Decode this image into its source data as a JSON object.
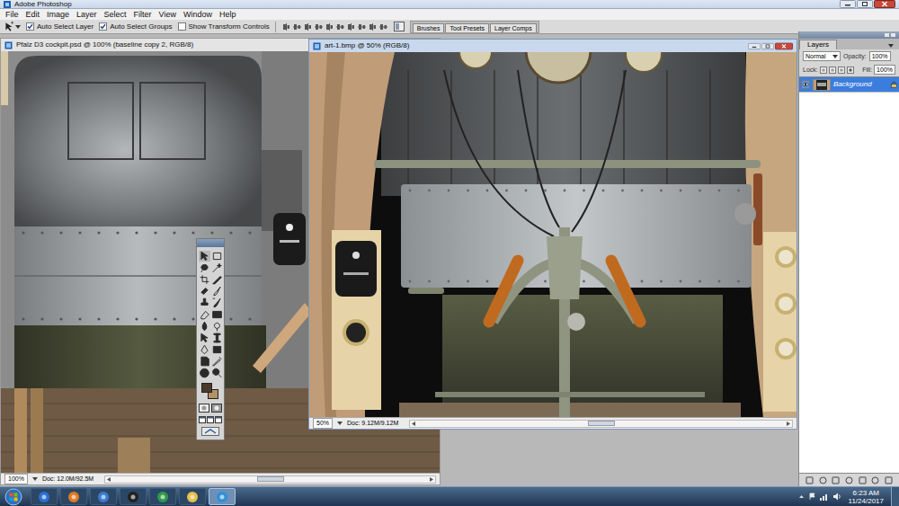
{
  "app": {
    "title": "Adobe Photoshop"
  },
  "menu": [
    "File",
    "Edit",
    "Image",
    "Layer",
    "Select",
    "Filter",
    "View",
    "Window",
    "Help"
  ],
  "options": [
    {
      "label": "Auto Select Layer",
      "checked": true
    },
    {
      "label": "Auto Select Groups",
      "checked": true
    },
    {
      "label": "Show Transform Controls",
      "checked": false
    }
  ],
  "palette_tabs": [
    "Brushes",
    "Tool Presets",
    "Layer Comps"
  ],
  "documents": [
    {
      "title": "Pfalz D3 cockpit.psd @ 100% (baseline copy 2, RGB/8)",
      "zoom": "100%",
      "doc_size": "Doc: 12.0M/92.5M",
      "active": false
    },
    {
      "title": "art-1.bmp @ 50% (RGB/8)",
      "zoom": "50%",
      "doc_size": "Doc: 9.12M/9.12M",
      "active": true
    }
  ],
  "layers_panel": {
    "tab": "Layers",
    "blend_mode": "Normal",
    "opacity_label": "Opacity:",
    "opacity": "100%",
    "lock_label": "Lock:",
    "fill_label": "Fill:",
    "fill": "100%",
    "layers": [
      {
        "name": "Background",
        "selected": true,
        "visible": true
      }
    ]
  },
  "taskbar": {
    "time": "6:23 AM",
    "date": "11/24/2017"
  }
}
